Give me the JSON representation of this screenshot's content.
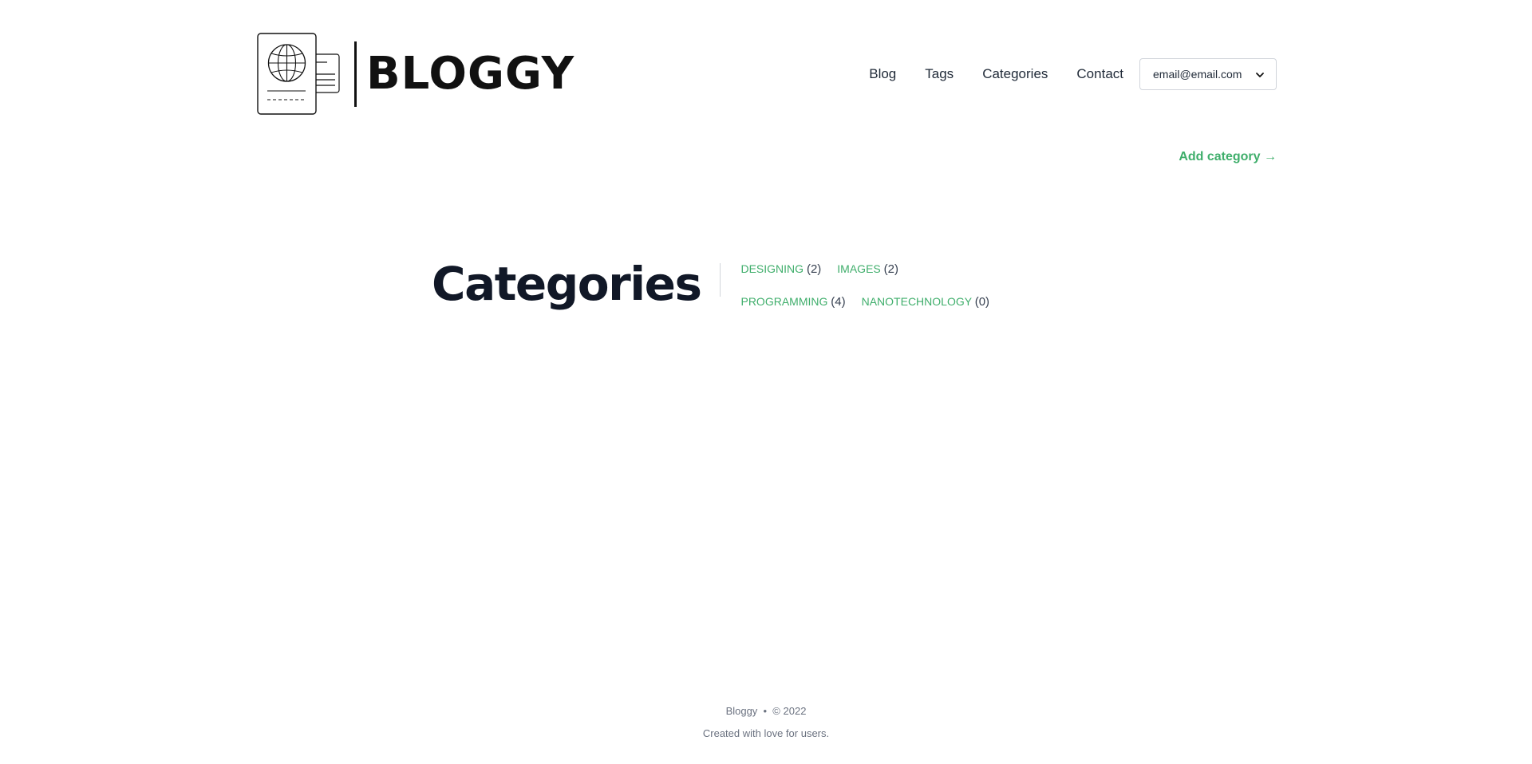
{
  "header": {
    "logo_text": "BLOGGY",
    "nav": [
      {
        "label": "Blog"
      },
      {
        "label": "Tags"
      },
      {
        "label": "Categories"
      },
      {
        "label": "Contact"
      }
    ],
    "user_email": "email@email.com"
  },
  "actions": {
    "add_category": "Add category →"
  },
  "page": {
    "title": "Categories"
  },
  "categories": [
    {
      "name": "DESIGNING",
      "count": "(2)"
    },
    {
      "name": "IMAGES",
      "count": "(2)"
    },
    {
      "name": "PROGRAMMING",
      "count": "(4)"
    },
    {
      "name": "NANOTECHNOLOGY",
      "count": "(0)"
    }
  ],
  "footer": {
    "line1": "Bloggy  •  © 2022",
    "line2": "Created with love for users."
  },
  "colors": {
    "accent_green": "#3fae6b",
    "heading": "#111827"
  }
}
